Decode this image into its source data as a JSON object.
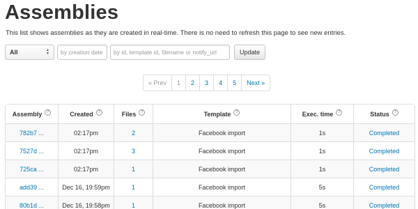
{
  "page": {
    "title": "Assemblies",
    "intro": "This list shows assemblies as they are created in real-time. There is no need to refresh this page to see new entries."
  },
  "filters": {
    "select_value": "All",
    "date_placeholder": "by creation date",
    "search_placeholder": "by id, template id, filename or notify_url",
    "update_label": "Update"
  },
  "pager": {
    "prev": "« Prev",
    "pages": [
      "1",
      "2",
      "3",
      "4",
      "5"
    ],
    "next": "Next »"
  },
  "table": {
    "headers": [
      "Assembly",
      "Created",
      "Files",
      "Template",
      "Exec. time",
      "Status"
    ],
    "help_glyph": "?",
    "rows": [
      {
        "assembly": "782b7 ...",
        "created": "02:17pm",
        "files": "2",
        "template": "Facebook import",
        "exec": "1s",
        "status": "Completed"
      },
      {
        "assembly": "7527d ...",
        "created": "02:17pm",
        "files": "3",
        "template": "Facebook import",
        "exec": "1s",
        "status": "Completed"
      },
      {
        "assembly": "725ca ...",
        "created": "02:17pm",
        "files": "1",
        "template": "Facebook import",
        "exec": "1s",
        "status": "Completed"
      },
      {
        "assembly": "add39 ...",
        "created": "Dec 16, 19:59pm",
        "files": "1",
        "template": "Facebook import",
        "exec": "5s",
        "status": "Completed"
      },
      {
        "assembly": "80b1d ...",
        "created": "Dec 16, 19:58pm",
        "files": "1",
        "template": "Facebook import",
        "exec": "5s",
        "status": "Completed"
      }
    ]
  },
  "colors": {
    "link": "#0077b3",
    "border": "#dddddd",
    "stripe": "#f9f9f9"
  }
}
